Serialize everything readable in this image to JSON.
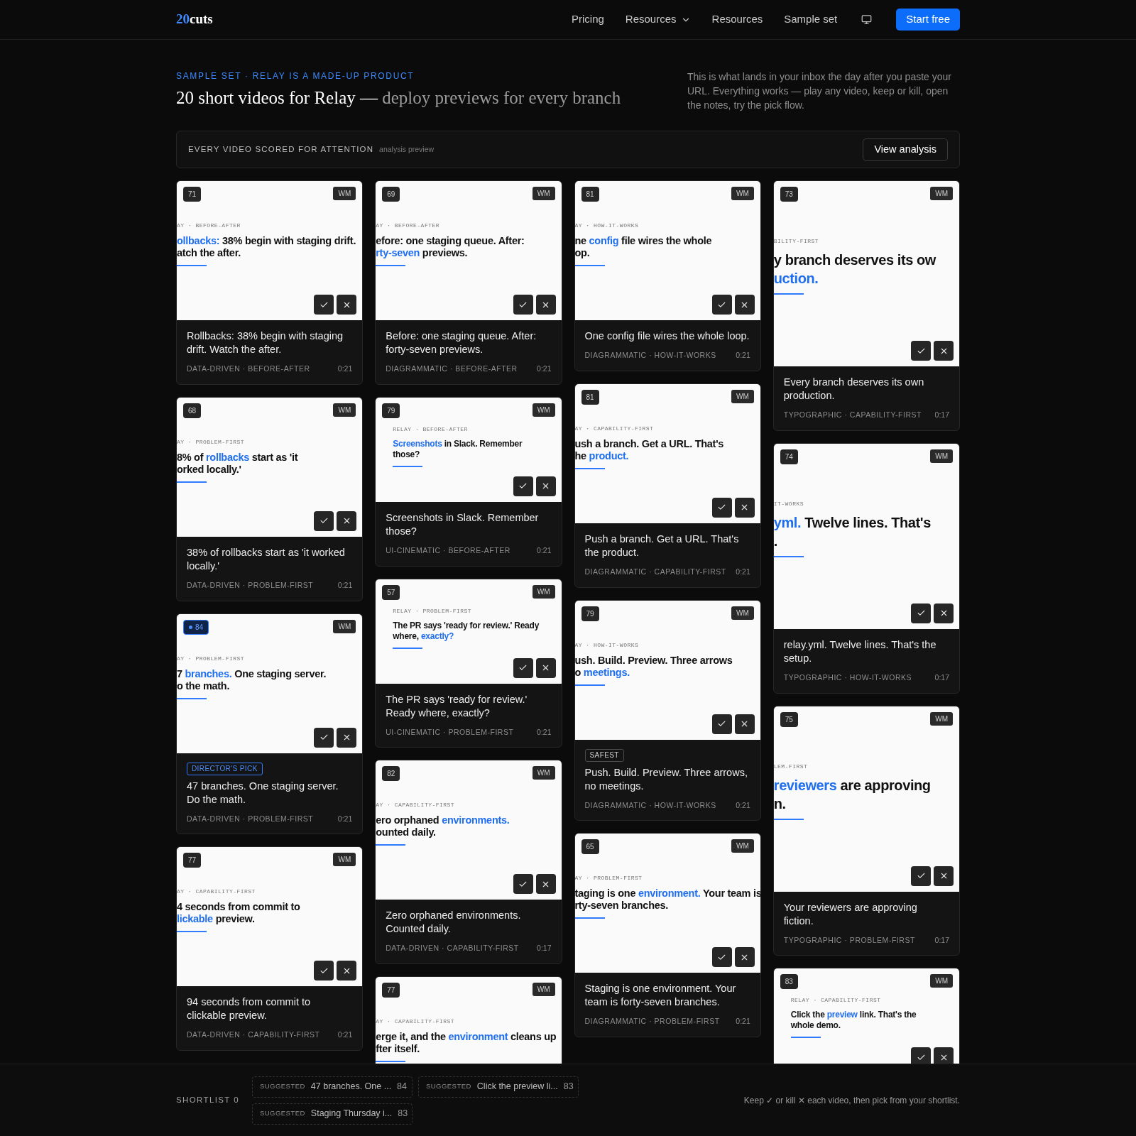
{
  "nav": {
    "logo_accent": "20",
    "logo_text": "cuts",
    "items": [
      {
        "kind": "link",
        "label": "Pricing"
      },
      {
        "kind": "dropdown",
        "label": "Resources"
      },
      {
        "kind": "link",
        "label": "Resources"
      },
      {
        "kind": "link",
        "label": "Sample set"
      },
      {
        "kind": "icon"
      },
      {
        "kind": "button",
        "label": "Start free"
      }
    ]
  },
  "hero": {
    "eyebrow": "SAMPLE SET · RELAY IS A MADE-UP PRODUCT",
    "title": "20 short videos for Relay —",
    "title_muted": "deploy previews for every branch",
    "intro": "This is what lands in your inbox the day after you paste your URL. Everything works — play any video, keep or kill, open the notes, try the pick flow."
  },
  "analysis": {
    "label": "EVERY VIDEO SCORED FOR ATTENTION",
    "note": "analysis preview",
    "button": "View analysis"
  },
  "columns": [
    {
      "cards": [
        {
          "kind": "landscape",
          "score": "71",
          "top_pick": false,
          "watermark": "WM",
          "eyebrow": "AY · BEFORE-AFTER",
          "lines": [
            [
              {
                "text": "ollbacks:",
                "accent": true
              },
              {
                "text": " 38% begin with staging drift.",
                "accent": false
              }
            ],
            [
              {
                "text": "atch the after.",
                "accent": false
              }
            ]
          ],
          "actions": true,
          "title": "Rollbacks: 38% begin with staging drift. Watch the after.",
          "tags": "DATA-DRIVEN · BEFORE-AFTER",
          "duration": "0:21"
        },
        {
          "kind": "landscape",
          "score": "68",
          "top_pick": false,
          "watermark": "WM",
          "eyebrow": "AY · PROBLEM-FIRST",
          "lines": [
            [
              {
                "text": "8% of ",
                "accent": false
              },
              {
                "text": "rollbacks",
                "accent": true
              },
              {
                "text": " start as 'it",
                "accent": false
              }
            ],
            [
              {
                "text": "orked locally.'",
                "accent": false
              }
            ]
          ],
          "actions": true,
          "title": "38% of rollbacks start as 'it worked locally.'",
          "tags": "DATA-DRIVEN · PROBLEM-FIRST",
          "duration": "0:21"
        },
        {
          "kind": "landscape",
          "score": "84",
          "top_pick": true,
          "watermark": "WM",
          "eyebrow": "AY · PROBLEM-FIRST",
          "lines": [
            [
              {
                "text": "7 ",
                "accent": false
              },
              {
                "text": "branches.",
                "accent": true
              },
              {
                "text": " One staging server.",
                "accent": false
              }
            ],
            [
              {
                "text": "o the math.",
                "accent": false
              }
            ]
          ],
          "actions": true,
          "badge": {
            "label": "DIRECTOR'S PICK",
            "kind": "pick"
          },
          "title": "47 branches. One staging server. Do the math.",
          "tags": "DATA-DRIVEN · PROBLEM-FIRST",
          "duration": "0:21"
        },
        {
          "kind": "landscape",
          "score": "77",
          "top_pick": false,
          "watermark": "WM",
          "eyebrow": "AY · CAPABILITY-FIRST",
          "lines": [
            [
              {
                "text": "4 seconds from commit to",
                "accent": false
              }
            ],
            [
              {
                "text": "lickable",
                "accent": true
              },
              {
                "text": " preview.",
                "accent": false
              }
            ]
          ],
          "actions": true,
          "title": "94 seconds from commit to clickable preview.",
          "tags": "DATA-DRIVEN · CAPABILITY-FIRST",
          "duration": "0:21"
        }
      ]
    },
    {
      "cards": [
        {
          "kind": "landscape",
          "score": "69",
          "top_pick": false,
          "watermark": "WM",
          "eyebrow": "AY · BEFORE-AFTER",
          "lines": [
            [
              {
                "text": "efore: one staging queue. After:",
                "accent": false
              }
            ],
            [
              {
                "text": "rty-seven",
                "accent": true
              },
              {
                "text": " previews.",
                "accent": false
              }
            ]
          ],
          "actions": true,
          "title": "Before: one staging queue. After: forty-seven previews.",
          "tags": "DIAGRAMMATIC · BEFORE-AFTER",
          "duration": "0:21"
        },
        {
          "kind": "compact",
          "score": "79",
          "top_pick": false,
          "watermark": "WM",
          "eyebrow": "RELAY · BEFORE-AFTER",
          "lines": [
            [
              {
                "text": "Screenshots",
                "accent": true
              },
              {
                "text": " in Slack. Remember",
                "accent": false
              }
            ],
            [
              {
                "text": "those?",
                "accent": false
              }
            ]
          ],
          "actions": true,
          "title": "Screenshots in Slack. Remember those?",
          "tags": "UI-CINEMATIC · BEFORE-AFTER",
          "duration": "0:21"
        },
        {
          "kind": "compact",
          "score": "57",
          "top_pick": false,
          "watermark": "WM",
          "eyebrow": "RELAY · PROBLEM-FIRST",
          "lines": [
            [
              {
                "text": "The PR says 'ready for review.' Ready",
                "accent": false
              }
            ],
            [
              {
                "text": "where, ",
                "accent": false
              },
              {
                "text": "exactly?",
                "accent": true
              }
            ]
          ],
          "actions": true,
          "title": "The PR says 'ready for review.' Ready where, exactly?",
          "tags": "UI-CINEMATIC · PROBLEM-FIRST",
          "duration": "0:21"
        },
        {
          "kind": "landscape",
          "score": "82",
          "top_pick": false,
          "watermark": "WM",
          "eyebrow": "AY · CAPABILITY-FIRST",
          "lines": [
            [
              {
                "text": "ero orphaned ",
                "accent": false
              },
              {
                "text": "environments.",
                "accent": true
              }
            ],
            [
              {
                "text": "ounted daily.",
                "accent": false
              }
            ]
          ],
          "actions": true,
          "title": "Zero orphaned environments. Counted daily.",
          "tags": "DATA-DRIVEN · CAPABILITY-FIRST",
          "duration": "0:17"
        },
        {
          "kind": "landscape",
          "score": "77",
          "top_pick": false,
          "watermark": "WM",
          "eyebrow": "AY · CAPABILITY-FIRST",
          "lines": [
            [
              {
                "text": "erge it, and the ",
                "accent": false
              },
              {
                "text": "environment",
                "accent": true
              },
              {
                "text": " cleans up",
                "accent": false
              }
            ],
            [
              {
                "text": "fter itself.",
                "accent": false
              }
            ]
          ],
          "actions": false
        }
      ]
    },
    {
      "cards": [
        {
          "kind": "landscape",
          "score": "81",
          "top_pick": false,
          "watermark": "WM",
          "eyebrow": "AY · HOW-IT-WORKS",
          "lines": [
            [
              {
                "text": "ne ",
                "accent": false
              },
              {
                "text": "config",
                "accent": true
              },
              {
                "text": " file wires the whole",
                "accent": false
              }
            ],
            [
              {
                "text": "op.",
                "accent": false
              }
            ]
          ],
          "actions": true,
          "title": "One config file wires the whole loop.",
          "tags": "DIAGRAMMATIC · HOW-IT-WORKS",
          "duration": "0:21"
        },
        {
          "kind": "landscape",
          "score": "81",
          "top_pick": false,
          "watermark": "WM",
          "eyebrow": "AY · CAPABILITY-FIRST",
          "lines": [
            [
              {
                "text": "ush a branch. Get a URL. That's",
                "accent": false
              }
            ],
            [
              {
                "text": "he ",
                "accent": false
              },
              {
                "text": "product.",
                "accent": true
              }
            ]
          ],
          "actions": true,
          "title": "Push a branch. Get a URL. That's the product.",
          "tags": "DIAGRAMMATIC · CAPABILITY-FIRST",
          "duration": "0:21"
        },
        {
          "kind": "landscape",
          "score": "79",
          "top_pick": false,
          "watermark": "WM",
          "eyebrow": "AY · HOW-IT-WORKS",
          "lines": [
            [
              {
                "text": "ush. Build. Preview. Three arrows",
                "accent": false
              }
            ],
            [
              {
                "text": "o ",
                "accent": false
              },
              {
                "text": "meetings.",
                "accent": true
              }
            ]
          ],
          "actions": true,
          "badge": {
            "label": "SAFEST",
            "kind": "neutral"
          },
          "title": "Push. Build. Preview. Three arrows, no meetings.",
          "tags": "DIAGRAMMATIC · HOW-IT-WORKS",
          "duration": "0:21"
        },
        {
          "kind": "landscape",
          "score": "65",
          "top_pick": false,
          "watermark": "WM",
          "eyebrow": "AY · PROBLEM-FIRST",
          "lines": [
            [
              {
                "text": "taging is one ",
                "accent": false
              },
              {
                "text": "environment.",
                "accent": true
              },
              {
                "text": " Your team is",
                "accent": false
              }
            ],
            [
              {
                "text": "rty-seven branches.",
                "accent": false
              }
            ]
          ],
          "actions": true,
          "title": "Staging is one environment. Your team is forty-seven branches.",
          "tags": "DIAGRAMMATIC · PROBLEM-FIRST",
          "duration": "0:21"
        }
      ]
    },
    {
      "cards": [
        {
          "kind": "portrait",
          "score": "73",
          "top_pick": false,
          "watermark": "WM",
          "eyebrow": "BILITY-FIRST",
          "lines": [
            [
              {
                "text": "y branch deserves its ow",
                "accent": false
              }
            ],
            [
              {
                "text": "uction.",
                "accent": true
              }
            ]
          ],
          "actions": true,
          "title": "Every branch deserves its own production.",
          "tags": "TYPOGRAPHIC · CAPABILITY-FIRST",
          "duration": "0:17"
        },
        {
          "kind": "portrait",
          "score": "74",
          "top_pick": false,
          "watermark": "WM",
          "eyebrow": "IT-WORKS",
          "lines": [
            [
              {
                "text": "yml.",
                "accent": true
              },
              {
                "text": " Twelve lines. That's",
                "accent": false
              }
            ],
            [
              {
                "text": ".",
                "accent": false
              }
            ]
          ],
          "actions": true,
          "title": "relay.yml. Twelve lines. That's the setup.",
          "tags": "TYPOGRAPHIC · HOW-IT-WORKS",
          "duration": "0:17"
        },
        {
          "kind": "portrait",
          "score": "75",
          "top_pick": false,
          "watermark": "WM",
          "eyebrow": "LEM-FIRST",
          "lines": [
            [
              {
                "text": "reviewers",
                "accent": true
              },
              {
                "text": " are approving",
                "accent": false
              }
            ],
            [
              {
                "text": "n.",
                "accent": false
              }
            ]
          ],
          "actions": true,
          "title": "Your reviewers are approving fiction.",
          "tags": "TYPOGRAPHIC · PROBLEM-FIRST",
          "duration": "0:17"
        },
        {
          "kind": "compact",
          "score": "83",
          "top_pick": false,
          "watermark": "WM",
          "eyebrow": "RELAY · CAPABILITY-FIRST",
          "lines": [
            [
              {
                "text": "Click the ",
                "accent": false
              },
              {
                "text": "preview",
                "accent": true
              },
              {
                "text": " link. That's the",
                "accent": false
              }
            ],
            [
              {
                "text": "whole demo.",
                "accent": false
              }
            ]
          ],
          "actions": true
        }
      ]
    }
  ],
  "shortlist": {
    "label": "SHORTLIST",
    "count": "0",
    "suggestions": [
      {
        "tag": "SUGGESTED",
        "text": "47 branches. One ...",
        "score": "84"
      },
      {
        "tag": "SUGGESTED",
        "text": "Click the preview li...",
        "score": "83"
      },
      {
        "tag": "SUGGESTED",
        "text": "Staging Thursday i...",
        "score": "83"
      }
    ],
    "hint": "Keep ✓ or kill ✕ each video, then pick from your shortlist."
  }
}
